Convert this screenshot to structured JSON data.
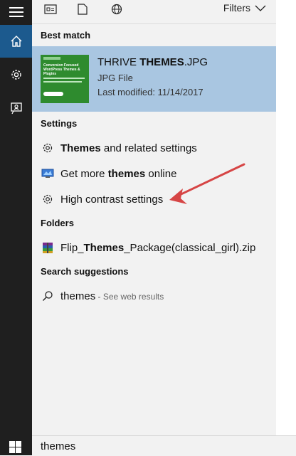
{
  "topbar": {
    "filters_label": "Filters",
    "icons": [
      "apps-icon",
      "document-icon",
      "web-icon",
      "chevron-down-icon"
    ]
  },
  "rail": {
    "items": [
      "hamburger-menu-icon",
      "home-icon",
      "settings-gear-icon",
      "feedback-icon",
      "windows-logo-icon"
    ],
    "active_color": "#1c5a8e"
  },
  "best_match": {
    "header": "Best match",
    "title_prefix": "THRIVE ",
    "title_bold": "THEMES",
    "title_suffix": ".JPG",
    "type": "JPG File",
    "modified": "Last modified: 11/14/2017",
    "thumb_text": "Conversion Focused WordPress Themes & Plugins",
    "highlight_color": "#a9c6e1"
  },
  "settings": {
    "header": "Settings",
    "items": [
      {
        "bold": "Themes",
        "rest": " and related settings"
      },
      {
        "pre": "Get more ",
        "bold": "themes",
        "post": " online"
      },
      {
        "plain": "High contrast settings"
      }
    ]
  },
  "folders": {
    "header": "Folders",
    "item": {
      "pre": "Flip_",
      "bold": "Themes",
      "post": "_Package(classical_girl).zip"
    }
  },
  "suggestions": {
    "header": "Search suggestions",
    "query": "themes",
    "hint": " - See web results"
  },
  "search": {
    "value": "themes"
  },
  "annotation": {
    "arrow_color": "#d64545"
  }
}
